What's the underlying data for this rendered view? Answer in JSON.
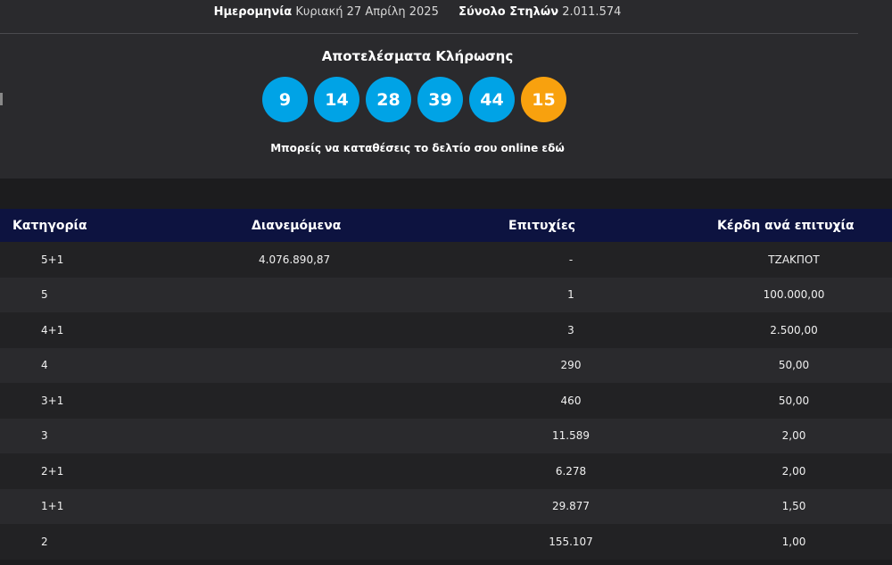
{
  "header": {
    "date_label": "Ημερομηνία",
    "date_value": "Κυριακή 27 Απρίλη 2025",
    "columns_label": "Σύνολο Στηλών",
    "columns_value": "2.011.574"
  },
  "results": {
    "title": "Αποτελέσματα Κλήρωσης",
    "numbers": [
      "9",
      "14",
      "28",
      "39",
      "44"
    ],
    "bonus": "15",
    "number_color": "#00a3e6",
    "bonus_color": "#f8a10e",
    "online_text": "Μπορείς να καταθέσεις το δελτίο σου online εδώ"
  },
  "table": {
    "headers": [
      "Κατηγορία",
      "Διανεμόμενα",
      "Επιτυχίες",
      "Κέρδη ανά επιτυχία"
    ],
    "rows": [
      [
        "5+1",
        "4.076.890,87",
        "-",
        "ΤΖΑΚΠΟΤ"
      ],
      [
        "5",
        "",
        "1",
        "100.000,00"
      ],
      [
        "4+1",
        "",
        "3",
        "2.500,00"
      ],
      [
        "4",
        "",
        "290",
        "50,00"
      ],
      [
        "3+1",
        "",
        "460",
        "50,00"
      ],
      [
        "3",
        "",
        "11.589",
        "2,00"
      ],
      [
        "2+1",
        "",
        "6.278",
        "2,00"
      ],
      [
        "1+1",
        "",
        "29.877",
        "1,50"
      ],
      [
        "2",
        "",
        "155.107",
        "1,00"
      ]
    ]
  }
}
